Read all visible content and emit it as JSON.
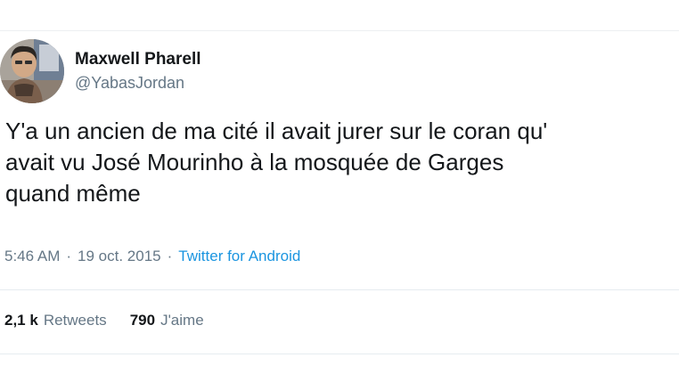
{
  "author": {
    "name": "Maxwell Pharell",
    "handle": "@YabasJordan",
    "avatar_icon": "user-photo-avatar"
  },
  "tweet": {
    "lines": [
      "Y'a un ancien de ma cité il avait jurer sur le coran qu'",
      "avait vu José Mourinho à la mosquée de Garges",
      "quand même"
    ]
  },
  "meta": {
    "time": "5:46 AM",
    "separator": "·",
    "date": "19 oct. 2015",
    "source": "Twitter for Android"
  },
  "stats": {
    "retweets_count": "2,1 k",
    "retweets_label": "Retweets",
    "likes_count": "790",
    "likes_label": "J'aime"
  },
  "colors": {
    "text": "#14171a",
    "secondary": "#657786",
    "link": "#1b95e0",
    "divider": "#e6ecf0"
  }
}
